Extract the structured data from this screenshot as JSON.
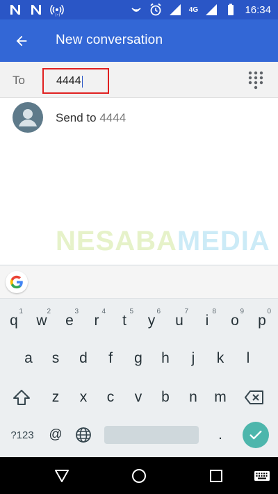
{
  "status_bar": {
    "time": "16:34",
    "network": "4G",
    "icons": [
      "n-notification-icon",
      "n-notification-icon",
      "hotspot-icon",
      "nfc-icon",
      "alarm-icon",
      "signal-icon",
      "battery-icon"
    ]
  },
  "app_bar": {
    "title": "New conversation",
    "back_icon": "arrow-left-icon"
  },
  "to_bar": {
    "label": "To",
    "input_value": "4444",
    "dialpad_icon": "dialpad-icon"
  },
  "suggestion": {
    "prefix": "Send to ",
    "number": "4444"
  },
  "watermark": {
    "part1": "NESABA",
    "part2": "MEDIA"
  },
  "keyboard": {
    "row1": [
      {
        "key": "q",
        "sup": "1"
      },
      {
        "key": "w",
        "sup": "2"
      },
      {
        "key": "e",
        "sup": "3"
      },
      {
        "key": "r",
        "sup": "4"
      },
      {
        "key": "t",
        "sup": "5"
      },
      {
        "key": "y",
        "sup": "6"
      },
      {
        "key": "u",
        "sup": "7"
      },
      {
        "key": "i",
        "sup": "8"
      },
      {
        "key": "o",
        "sup": "9"
      },
      {
        "key": "p",
        "sup": "0"
      }
    ],
    "row2": [
      "a",
      "s",
      "d",
      "f",
      "g",
      "h",
      "j",
      "k",
      "l"
    ],
    "row3": [
      "z",
      "x",
      "c",
      "v",
      "b",
      "n",
      "m"
    ],
    "symbols_key": "?123",
    "at_key": "@",
    "period_key": "."
  },
  "colors": {
    "status_bar": "#2a56c6",
    "app_bar": "#3367d6",
    "highlight": "#e02020",
    "enter": "#4db6ac"
  }
}
